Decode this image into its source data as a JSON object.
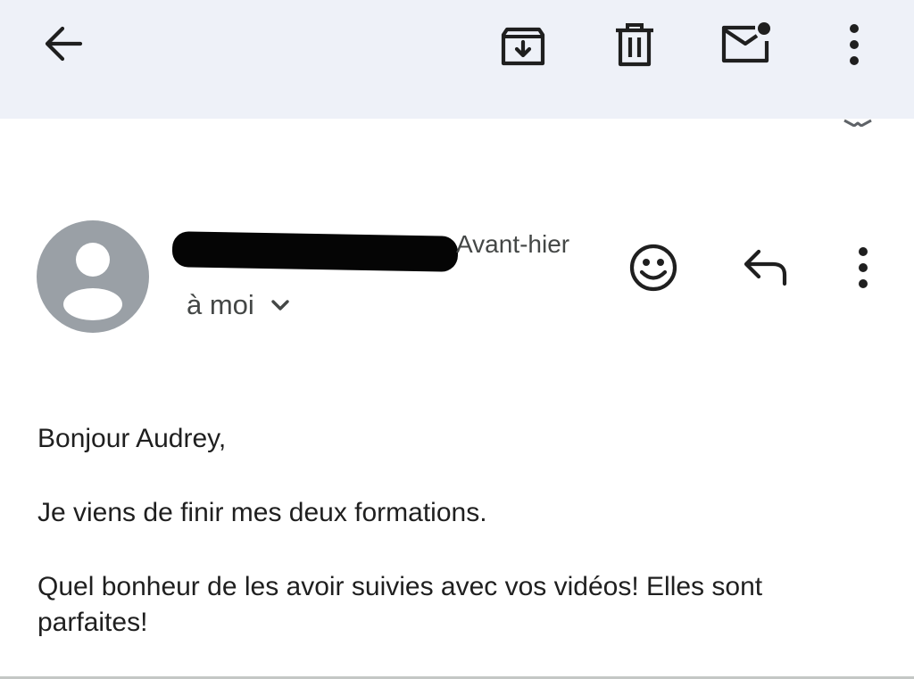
{
  "toolbar": {
    "back_icon": "arrow-left-icon",
    "archive_icon": "archive-icon",
    "delete_icon": "trash-icon",
    "mark_unread_icon": "mail-unread-icon",
    "more_icon": "more-vert-icon"
  },
  "email": {
    "sender_name": "",
    "date": "Avant-hier",
    "recipient_label": "à moi",
    "avatar_icon": "person-icon",
    "react_icon": "emoji-icon",
    "reply_icon": "reply-icon",
    "more_icon": "more-vert-icon",
    "body": {
      "greeting": "Bonjour Audrey,",
      "line1": "Je viens de finir mes deux formations.",
      "line2": "Quel bonheur de les avoir suivies avec vos vidéos! Elles sont parfaites!"
    }
  },
  "colors": {
    "toolbar_bg": "#eef1f8",
    "avatar_bg": "#9aa0a6",
    "icon": "#1f1f1f",
    "secondary_text": "#444746"
  }
}
